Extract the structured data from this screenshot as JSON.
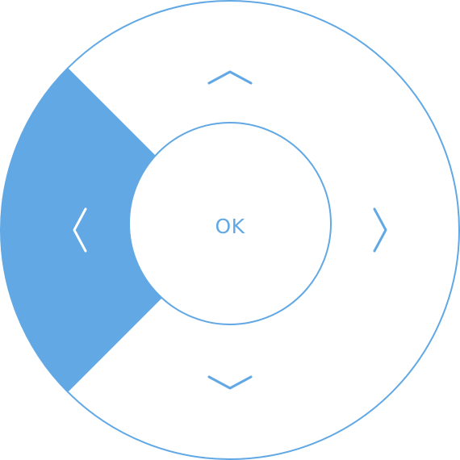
{
  "remote": {
    "ok_label": "OK",
    "pressed_segment": "left",
    "icons": {
      "up": "chevron-up-icon",
      "down": "chevron-down-icon",
      "left": "chevron-left-icon",
      "right": "chevron-right-icon"
    }
  },
  "colors": {
    "accent": "#61a8e4",
    "background": "#ffffff",
    "pressed_arrow": "#ffffff"
  }
}
